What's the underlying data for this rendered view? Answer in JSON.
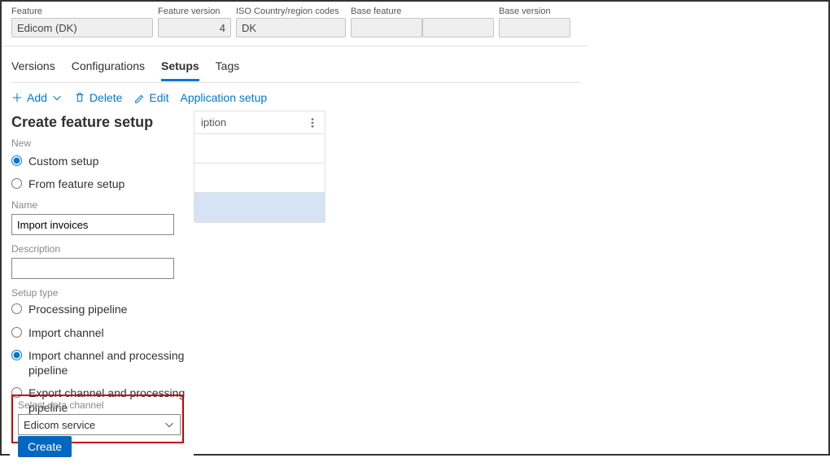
{
  "headerFields": {
    "feature": {
      "label": "Feature",
      "value": "Edicom (DK)"
    },
    "version": {
      "label": "Feature version",
      "value": "4"
    },
    "iso": {
      "label": "ISO Country/region codes",
      "value": "DK"
    },
    "baseFeature": {
      "label": "Base feature",
      "value": ""
    },
    "baseVersion": {
      "label": "Base version",
      "value": ""
    }
  },
  "tabs": [
    "Versions",
    "Configurations",
    "Setups",
    "Tags"
  ],
  "toolbar": {
    "add": "Add",
    "delete": "Delete",
    "edit": "Edit",
    "appSetup": "Application setup"
  },
  "bgList": {
    "header": "iption"
  },
  "panel": {
    "title": "Create feature setup",
    "newLabel": "New",
    "newOptions": {
      "custom": "Custom setup",
      "fromFeature": "From feature setup"
    },
    "nameLabel": "Name",
    "nameValue": "Import invoices",
    "descLabel": "Description",
    "descValue": "",
    "setupTypeLabel": "Setup type",
    "setupTypeOptions": {
      "pipeline": "Processing pipeline",
      "importChannel": "Import channel",
      "importChannelPipeline": "Import channel and processing pipeline",
      "exportChannelPipeline": "Export channel and processing pipeline"
    },
    "dataChannelLabel": "Select data channel",
    "dataChannelValue": "Edicom service",
    "createBtn": "Create"
  }
}
